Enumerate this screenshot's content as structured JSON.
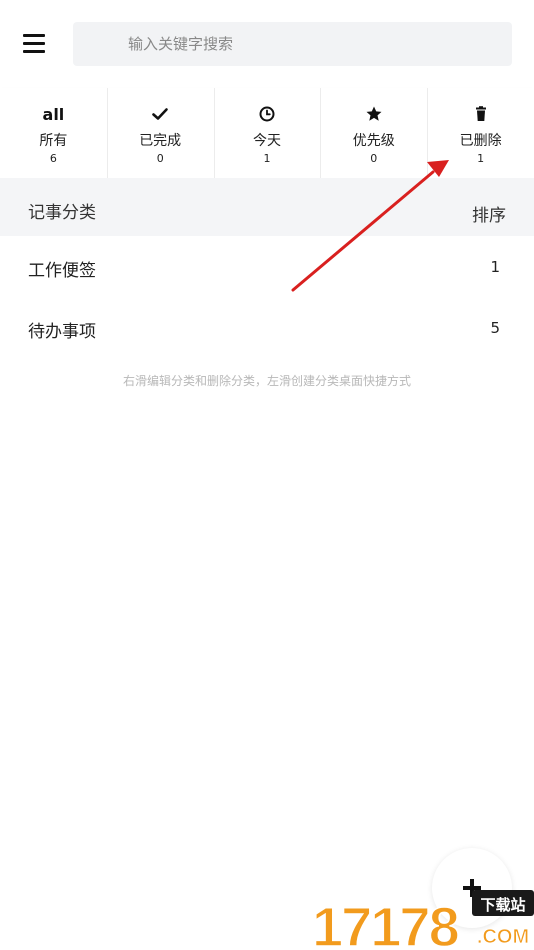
{
  "search": {
    "placeholder": "输入关键字搜索"
  },
  "filters": [
    {
      "icon": "all-text",
      "icon_text": "all",
      "label": "所有",
      "count": "6"
    },
    {
      "icon": "check-icon",
      "label": "已完成",
      "count": "0"
    },
    {
      "icon": "clock-icon",
      "label": "今天",
      "count": "1"
    },
    {
      "icon": "star-icon",
      "label": "优先级",
      "count": "0"
    },
    {
      "icon": "trash-icon",
      "label": "已删除",
      "count": "1"
    }
  ],
  "section": {
    "title": "记事分类",
    "sort_label": "排序"
  },
  "categories": [
    {
      "name": "工作便签",
      "count": "1"
    },
    {
      "name": "待办事项",
      "count": "5"
    }
  ],
  "hint": "右滑编辑分类和删除分类，左滑创建分类桌面快捷方式",
  "fab": {
    "icon": "plus-icon"
  },
  "watermark": {
    "number": "17178",
    "site": "下载站",
    "tld": ".COM"
  },
  "colors": {
    "annotation_arrow": "#d9201f",
    "watermark_orange": "#f29b1d"
  }
}
